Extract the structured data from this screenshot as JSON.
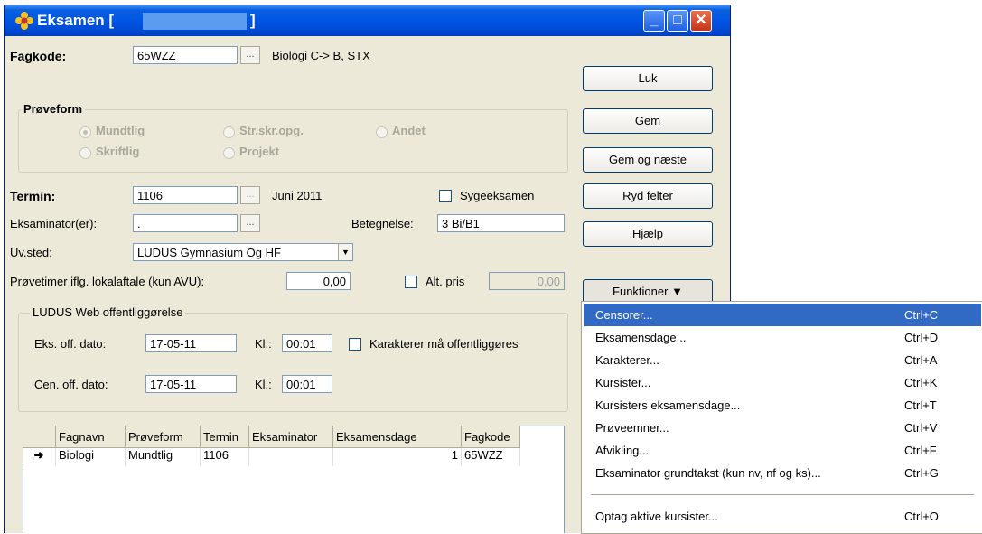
{
  "window": {
    "title": "Eksamen [",
    "title_close_bracket": "]",
    "controls": {
      "minimize": "_",
      "maximize": "□",
      "close": "✕"
    }
  },
  "fagkode": {
    "label": "Fagkode:",
    "value": "65WZZ",
    "browse": "...",
    "description": "Biologi C-> B, STX"
  },
  "proveform": {
    "title": "Prøveform",
    "options": [
      {
        "label": "Mundtlig",
        "selected": true
      },
      {
        "label": "Skriftlig",
        "selected": false
      },
      {
        "label": "Str.skr.opg.",
        "selected": false
      },
      {
        "label": "Projekt",
        "selected": false
      },
      {
        "label": "Andet",
        "selected": false
      }
    ]
  },
  "termin": {
    "label": "Termin:",
    "value": "1106",
    "browse": "...",
    "description": "Juni 2011",
    "sygeeksamen_label": "Sygeeksamen"
  },
  "eksaminator": {
    "label": "Eksaminator(er):",
    "value": ".",
    "browse": "..."
  },
  "betegnelse": {
    "label": "Betegnelse:",
    "value": "3 Bi/B1"
  },
  "uvsted": {
    "label": "Uv.sted:",
    "value": "LUDUS Gymnasium Og HF"
  },
  "provetimer": {
    "label": "Prøvetimer iflg. lokalaftale (kun AVU):",
    "value": "0,00",
    "alt_pris_label": "Alt. pris",
    "alt_pris_value": "0,00"
  },
  "web": {
    "title": "LUDUS Web offentliggørelse",
    "eks_label": "Eks. off. dato:",
    "eks_date": "17-05-11",
    "eks_kl_label": "Kl.:",
    "eks_kl": "00:01",
    "karakterer_label": "Karakterer må offentliggøres",
    "cen_label": "Cen. off. dato:",
    "cen_date": "17-05-11",
    "cen_kl_label": "Kl.:",
    "cen_kl": "00:01"
  },
  "grid": {
    "columns": [
      "Fagnavn",
      "Prøveform",
      "Termin",
      "Eksaminator",
      "Eksamensdage",
      "Fagkode"
    ],
    "rows": [
      {
        "marker": "➜",
        "cells": [
          "Biologi",
          "Mundtlig",
          "1106",
          "",
          "1",
          "65WZZ"
        ]
      }
    ]
  },
  "buttons": [
    "Luk",
    "Gem",
    "Gem og næste",
    "Ryd felter",
    "Hjælp",
    "Funktioner"
  ],
  "funktioner_arrow": "▼",
  "menu": {
    "items": [
      {
        "label": "Censorer...",
        "shortcut": "Ctrl+C",
        "selected": true
      },
      {
        "label": "Eksamensdage...",
        "shortcut": "Ctrl+D"
      },
      {
        "label": "Karakterer...",
        "shortcut": "Ctrl+A"
      },
      {
        "label": "Kursister...",
        "shortcut": "Ctrl+K"
      },
      {
        "label": "Kursisters eksamensdage...",
        "shortcut": "Ctrl+T"
      },
      {
        "label": "Prøveemner...",
        "shortcut": "Ctrl+V"
      },
      {
        "label": "Afvikling...",
        "shortcut": "Ctrl+F"
      },
      {
        "label": "Eksaminator grundtakst (kun nv, nf og ks)...",
        "shortcut": "Ctrl+G"
      },
      {
        "label": "Optag aktive kursister...",
        "shortcut": "Ctrl+O"
      }
    ]
  }
}
